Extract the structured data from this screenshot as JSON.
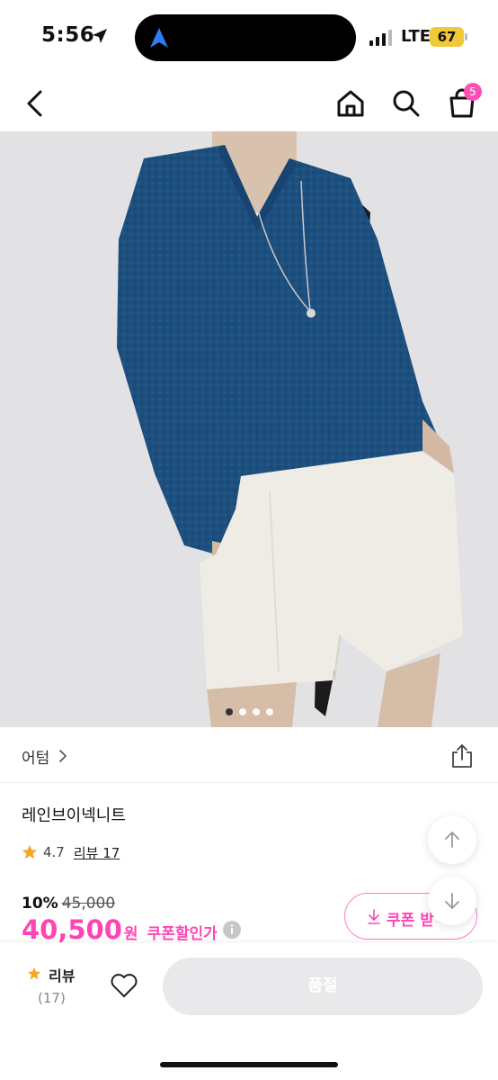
{
  "status_bar": {
    "time": "5:56",
    "network": "LTE",
    "battery": "67"
  },
  "nav": {
    "cart_count": "5"
  },
  "gallery": {
    "total_images": 4,
    "current_index": 1
  },
  "product": {
    "brand": "어텀",
    "name": "레인브이넥니트",
    "rating": "4.7",
    "review_label": "리뷰 17",
    "discount_rate": "10%",
    "original_price": "45,000",
    "price": "40,500",
    "currency": "원",
    "coupon_note": "쿠폰할인가"
  },
  "coupon_button": {
    "label": "쿠폰 받"
  },
  "bottom_bar": {
    "review_label": "리뷰",
    "review_count": "(17)",
    "cta_label": "품절"
  },
  "colors": {
    "accent": "#ff45b6",
    "star": "#f5a623",
    "sweater": "#1d4f7e",
    "shorts": "#efece6"
  }
}
